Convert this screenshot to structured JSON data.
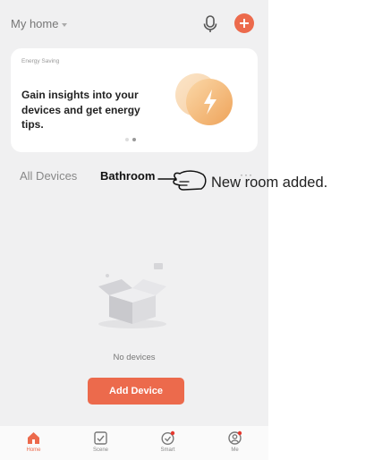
{
  "header": {
    "home_name": "My home"
  },
  "card": {
    "label": "Energy Saving",
    "text": "Gain insights into your devices and get energy tips."
  },
  "tabs": [
    {
      "label": "All Devices"
    },
    {
      "label": "Bathroom"
    }
  ],
  "more_label": "···",
  "annotation": "New room added.",
  "empty": {
    "message": "No devices",
    "button": "Add Device"
  },
  "nav": [
    {
      "label": "Home",
      "icon": "home-icon",
      "active": true
    },
    {
      "label": "Scene",
      "icon": "scene-icon",
      "active": false
    },
    {
      "label": "Smart",
      "icon": "smart-icon",
      "active": false
    },
    {
      "label": "Me",
      "icon": "me-icon",
      "active": false
    }
  ],
  "colors": {
    "accent": "#ec6a4c",
    "background": "#f0f0f1",
    "energy": "#f1a35c"
  }
}
